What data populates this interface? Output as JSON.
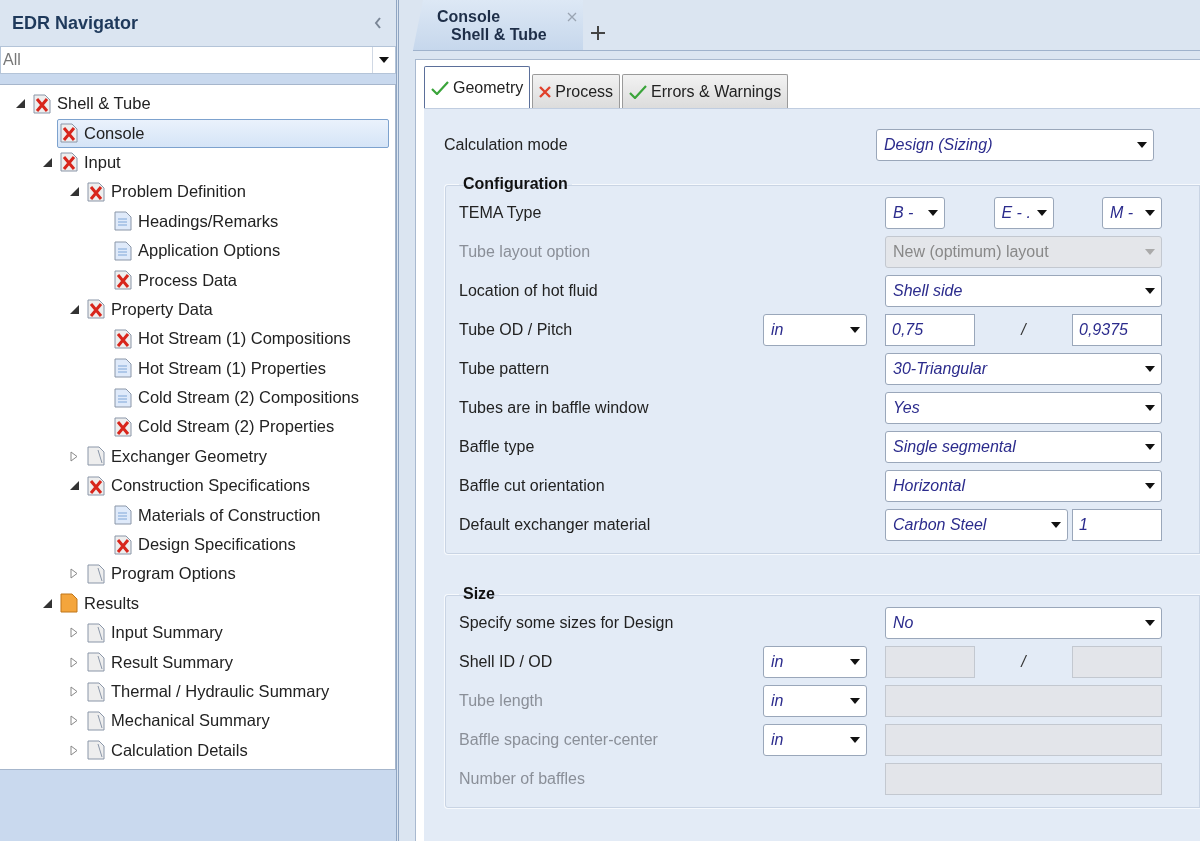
{
  "navigator": {
    "title": "EDR Navigator",
    "filter": {
      "value": "All"
    },
    "tree": [
      {
        "label": "Shell & Tube",
        "kind": "error",
        "selected": false,
        "expanded": true,
        "children": [
          {
            "label": "Console",
            "kind": "error-page",
            "selected": true
          },
          {
            "label": "Input",
            "kind": "error",
            "selected": false,
            "expanded": true,
            "children": [
              {
                "label": "Problem Definition",
                "kind": "error",
                "selected": false,
                "expanded": true,
                "children": [
                  {
                    "label": "Headings/Remarks",
                    "kind": "page",
                    "selected": false
                  },
                  {
                    "label": "Application Options",
                    "kind": "page",
                    "selected": false
                  },
                  {
                    "label": "Process Data",
                    "kind": "error-page",
                    "selected": false
                  }
                ]
              },
              {
                "label": "Property Data",
                "kind": "error",
                "selected": false,
                "expanded": true,
                "children": [
                  {
                    "label": "Hot Stream (1) Compositions",
                    "kind": "error-page",
                    "selected": false
                  },
                  {
                    "label": "Hot Stream (1) Properties",
                    "kind": "page",
                    "selected": false
                  },
                  {
                    "label": "Cold Stream (2) Compositions",
                    "kind": "page",
                    "selected": false
                  },
                  {
                    "label": "Cold Stream (2) Properties",
                    "kind": "error-page",
                    "selected": false
                  }
                ]
              },
              {
                "label": "Exchanger Geometry",
                "kind": "folder",
                "selected": false,
                "expanded": false
              },
              {
                "label": "Construction Specifications",
                "kind": "error",
                "selected": false,
                "expanded": true,
                "children": [
                  {
                    "label": "Materials of Construction",
                    "kind": "page",
                    "selected": false
                  },
                  {
                    "label": "Design Specifications",
                    "kind": "error-page",
                    "selected": false
                  }
                ]
              },
              {
                "label": "Program Options",
                "kind": "folder",
                "selected": false,
                "expanded": false
              }
            ]
          },
          {
            "label": "Results",
            "kind": "results",
            "selected": false,
            "expanded": true,
            "children": [
              {
                "label": "Input Summary",
                "kind": "folder",
                "selected": false,
                "expanded": false
              },
              {
                "label": "Result Summary",
                "kind": "folder",
                "selected": false,
                "expanded": false
              },
              {
                "label": "Thermal / Hydraulic Summary",
                "kind": "folder",
                "selected": false,
                "expanded": false
              },
              {
                "label": "Mechanical Summary",
                "kind": "folder",
                "selected": false,
                "expanded": false
              },
              {
                "label": "Calculation Details",
                "kind": "folder",
                "selected": false,
                "expanded": false
              }
            ]
          }
        ]
      }
    ]
  },
  "document_tabs": [
    {
      "title": "Console",
      "subtitle": "Shell & Tube",
      "selected": true
    }
  ],
  "tabs": [
    {
      "label": "Geometry",
      "kind": "ok",
      "selected": true
    },
    {
      "label": "Process",
      "kind": "error",
      "selected": false
    },
    {
      "label": "Errors & Warnings",
      "kind": "ok",
      "selected": false
    }
  ],
  "calculation_mode": {
    "label": "Calculation mode",
    "value": "Design (Sizing)"
  },
  "groups": [
    {
      "title": "Configuration",
      "rows": [
        {
          "label": "TEMA Type",
          "disabled": false,
          "controls": [
            {
              "kind": "select",
              "value": "B - ",
              "disabled": false
            },
            {
              "kind": "select",
              "value": "E - .",
              "disabled": false
            },
            {
              "kind": "select",
              "value": "M - ",
              "disabled": false
            }
          ]
        },
        {
          "label": "Tube layout option",
          "disabled": true,
          "controls": [
            {
              "kind": "select",
              "value": "New (optimum) layout",
              "disabled": true
            }
          ]
        },
        {
          "label": "Location of hot fluid",
          "disabled": false,
          "controls": [
            {
              "kind": "select",
              "value": "Shell side",
              "disabled": false
            }
          ]
        },
        {
          "label": "Tube OD / Pitch",
          "disabled": false,
          "unit": "in",
          "controls": [
            {
              "kind": "input",
              "value": "0,75",
              "disabled": false
            },
            {
              "kind": "separator",
              "text": "/"
            },
            {
              "kind": "input",
              "value": "0,9375",
              "disabled": false
            }
          ]
        },
        {
          "label": "Tube pattern",
          "disabled": false,
          "controls": [
            {
              "kind": "select",
              "value": "30-Triangular",
              "disabled": false
            }
          ]
        },
        {
          "label": "Tubes are in baffle window",
          "disabled": false,
          "controls": [
            {
              "kind": "select",
              "value": "Yes",
              "disabled": false
            }
          ]
        },
        {
          "label": "Baffle type",
          "disabled": false,
          "controls": [
            {
              "kind": "select",
              "value": "Single segmental",
              "disabled": false
            }
          ]
        },
        {
          "label": "Baffle cut orientation",
          "disabled": false,
          "controls": [
            {
              "kind": "select",
              "value": "Horizontal",
              "disabled": false
            }
          ]
        },
        {
          "label": "Default exchanger material",
          "disabled": false,
          "controls": [
            {
              "kind": "select",
              "value": "Carbon Steel",
              "disabled": false
            },
            {
              "kind": "input",
              "value": "1",
              "disabled": false
            }
          ]
        }
      ]
    },
    {
      "title": "Size",
      "rows": [
        {
          "label": "Specify some sizes for Design",
          "disabled": false,
          "controls": [
            {
              "kind": "select",
              "value": "No",
              "disabled": false
            }
          ]
        },
        {
          "label": "Shell ID / OD",
          "disabled": false,
          "unit": "in",
          "controls": [
            {
              "kind": "input",
              "disabled": true
            },
            {
              "kind": "separator",
              "text": "/"
            },
            {
              "kind": "input",
              "disabled": true
            }
          ]
        },
        {
          "label": "Tube length",
          "disabled": true,
          "unit": "in",
          "controls": [
            {
              "kind": "input",
              "disabled": true
            }
          ]
        },
        {
          "label": "Baffle spacing center-center",
          "disabled": true,
          "unit": "in",
          "controls": [
            {
              "kind": "input",
              "disabled": true
            }
          ]
        },
        {
          "label": "Number of baffles",
          "disabled": true,
          "controls": [
            {
              "kind": "input",
              "disabled": true
            }
          ]
        }
      ]
    }
  ]
}
